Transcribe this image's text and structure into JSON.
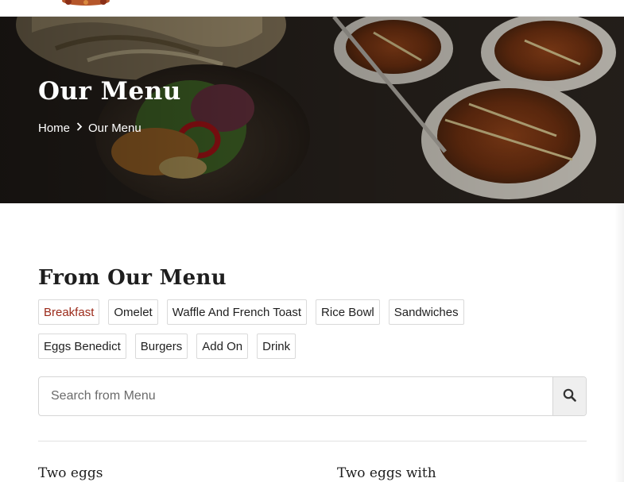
{
  "header": {
    "logo_icon": "restaurant-logo"
  },
  "hero": {
    "title": "Our Menu",
    "breadcrumb": {
      "home": "Home",
      "separator_icon": "chevron-right-icon",
      "current": "Our Menu"
    }
  },
  "menu": {
    "section_title": "From Our Menu",
    "categories_row1": [
      "Breakfast",
      "Omelet",
      "Waffle And French Toast",
      "Rice Bowl",
      "Sandwiches"
    ],
    "categories_row2": [
      "Eggs Benedict",
      "Burgers",
      "Add On",
      "Drink"
    ],
    "active_category": "Breakfast",
    "active_color": "#9b2a1a",
    "search": {
      "placeholder": "Search from Menu",
      "button_icon": "search-icon"
    },
    "items": [
      {
        "title": "Two eggs"
      },
      {
        "title": "Two eggs with"
      }
    ]
  }
}
